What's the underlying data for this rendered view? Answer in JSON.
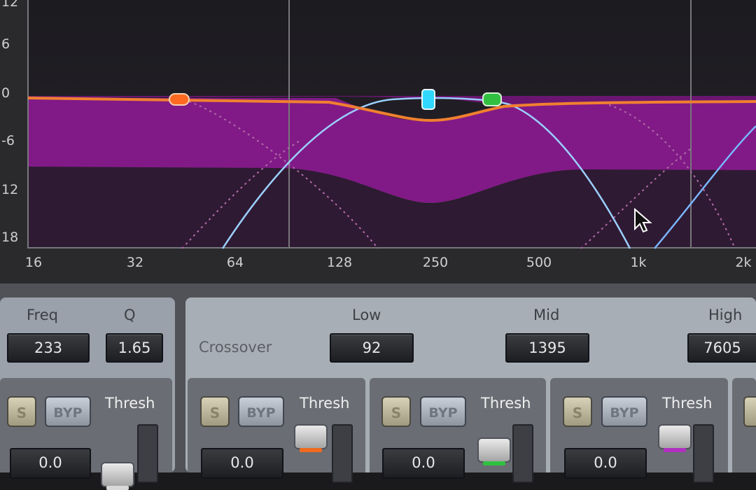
{
  "graph": {
    "y_labels": [
      "12",
      "6",
      "0",
      "-6",
      "12",
      "18"
    ],
    "x_labels": [
      "16",
      "32",
      "64",
      "128",
      "250",
      "500",
      "1k",
      "2k"
    ],
    "colors": {
      "background": "#2a2a2d",
      "fill": "#8a1a8f",
      "orange": "#f08030",
      "blue": "#9bd0ff",
      "node_cyan": "#30d8ff",
      "node_green": "#32c040",
      "node_orange": "#ff6a20"
    }
  },
  "crossover_panel": {
    "freq_label": "Freq",
    "freq_value": "233",
    "q_label": "Q",
    "q_value": "1.65",
    "crossover_label": "Crossover",
    "low_label": "Low",
    "low_value": "92",
    "mid_label": "Mid",
    "mid_value": "1395",
    "high_label": "High",
    "high_value": "7605"
  },
  "bands": [
    {
      "solo": "S",
      "bypass": "BYP",
      "thresh_label": "Thresh",
      "value": "0.0",
      "color": "#e0e0e0"
    },
    {
      "solo": "S",
      "bypass": "BYP",
      "thresh_label": "Thresh",
      "value": "0.0",
      "color": "#f06a20"
    },
    {
      "solo": "S",
      "bypass": "BYP",
      "thresh_label": "Thresh",
      "value": "0.0",
      "color": "#30c040"
    },
    {
      "solo": "S",
      "bypass": "BYP",
      "thresh_label": "Thresh",
      "value": "0.0",
      "color": "#b030c0"
    }
  ]
}
